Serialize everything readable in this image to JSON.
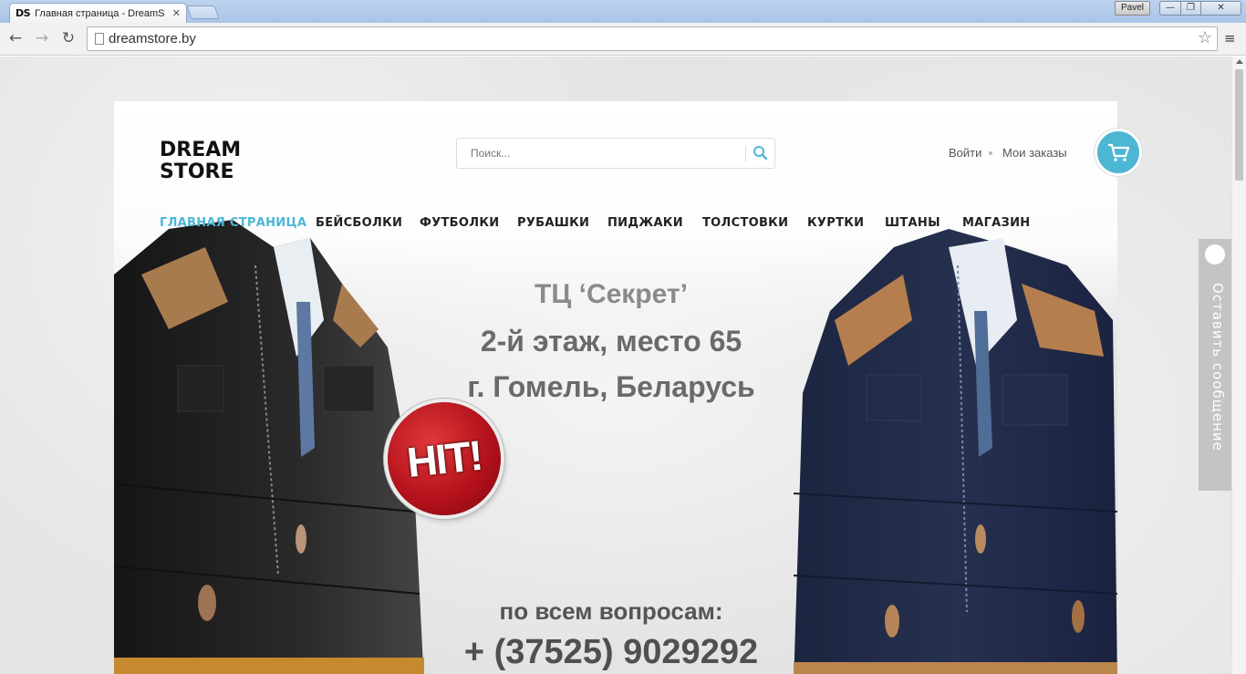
{
  "browser": {
    "tab_favicon": "DS",
    "tab_title": "Главная страница - DreamS",
    "tab_close": "✕",
    "user": "Pavel",
    "win_min": "—",
    "win_max": "❐",
    "win_close": "✕",
    "url": "dreamstore.by",
    "star": "☆",
    "menu": "≡",
    "back": "←",
    "forward": "→",
    "reload": "↻"
  },
  "site": {
    "logo_line1": "DREAM",
    "logo_line2": "STORE",
    "search_placeholder": "Поиск...",
    "login": "Войти",
    "orders": "Мои заказы",
    "accent": "#4db7d3",
    "nav": [
      {
        "label": "ГЛАВНАЯ СТРАНИЦА",
        "active": true
      },
      {
        "label": "БЕЙСБОЛКИ"
      },
      {
        "label": "ФУТБОЛКИ"
      },
      {
        "label": "РУБАШКИ"
      },
      {
        "label": "ПИДЖАКИ"
      },
      {
        "label": "ТОЛСТОВКИ"
      },
      {
        "label": "КУРТКИ"
      },
      {
        "label": "ШТАНЫ"
      },
      {
        "label": "МАГАЗИН"
      }
    ],
    "banner": {
      "line1": "ТЦ ‘Секрет’",
      "line2": "2-й этаж, место 65",
      "line3": "г. Гомель, Беларусь",
      "badge": "HIT!",
      "contact_label": "по всем вопросам:",
      "phone": "+ (37525) 9029292"
    },
    "feedback": "Оставить сообщение"
  }
}
